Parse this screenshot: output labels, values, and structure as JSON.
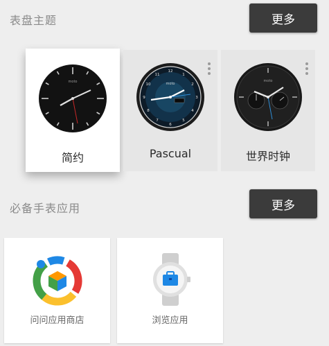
{
  "sections": {
    "watch_faces": {
      "title": "表盘主题",
      "more_label": "更多",
      "items": [
        {
          "label": "简约",
          "selected": true
        },
        {
          "label": "Pascual",
          "selected": false
        },
        {
          "label": "世界时钟",
          "selected": false
        }
      ]
    },
    "apps": {
      "title": "必备手表应用",
      "more_label": "更多",
      "items": [
        {
          "label": "问问应用商店"
        },
        {
          "label": "浏览应用"
        }
      ]
    }
  },
  "watch_brand": "moto",
  "colors": {
    "background": "#eeeeee",
    "button": "#3b3b3b",
    "accent_blue": "#2f8fd8",
    "second_hand": "#c62828"
  }
}
